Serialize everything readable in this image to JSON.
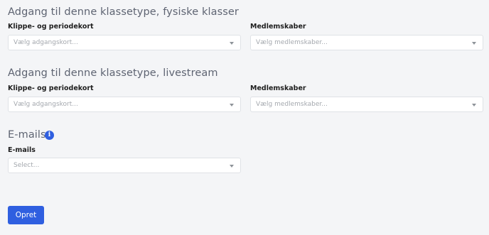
{
  "sections": [
    {
      "title": "Adgang til denne klassetype, fysiske klasser",
      "fields": [
        {
          "label": "Klippe- og periodekort",
          "placeholder": "Vælg adgangskort..."
        },
        {
          "label": "Medlemskaber",
          "placeholder": "Vælg medlemskaber..."
        }
      ]
    },
    {
      "title": "Adgang til denne klassetype, livestream",
      "fields": [
        {
          "label": "Klippe- og periodekort",
          "placeholder": "Vælg adgangskort..."
        },
        {
          "label": "Medlemskaber",
          "placeholder": "Vælg medlemskaber..."
        }
      ]
    },
    {
      "title": "E-mails",
      "info_icon": "i",
      "fields": [
        {
          "label": "E-mails",
          "placeholder": "Select..."
        }
      ]
    }
  ],
  "submit_label": "Opret",
  "colors": {
    "accent": "#2f5fe0",
    "background": "#f4f5f7",
    "section_title": "#5e6472"
  }
}
